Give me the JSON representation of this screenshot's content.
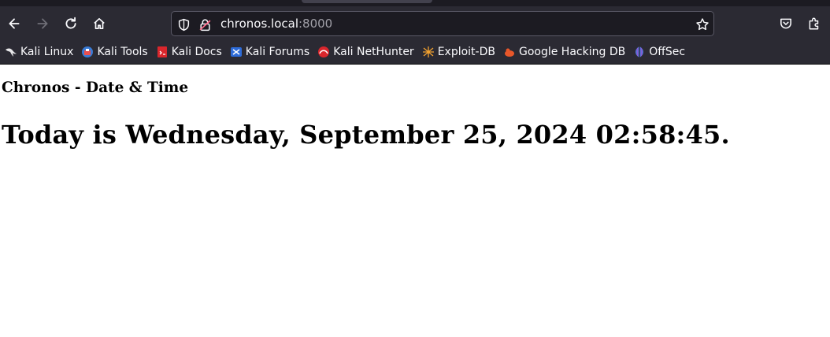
{
  "browser": {
    "url_host": "chronos.local",
    "url_port": ":8000",
    "bookmarks": [
      {
        "label": "Kali Linux",
        "icon": "kali-dragon-icon"
      },
      {
        "label": "Kali Tools",
        "icon": "kali-tools-icon"
      },
      {
        "label": "Kali Docs",
        "icon": "kali-docs-icon"
      },
      {
        "label": "Kali Forums",
        "icon": "kali-forums-icon"
      },
      {
        "label": "Kali NetHunter",
        "icon": "kali-nethunter-icon"
      },
      {
        "label": "Exploit-DB",
        "icon": "exploit-db-icon"
      },
      {
        "label": "Google Hacking DB",
        "icon": "google-hacking-db-icon"
      },
      {
        "label": "OffSec",
        "icon": "offsec-icon"
      }
    ]
  },
  "page": {
    "site_title": "Chronos - Date & Time",
    "headline": "Today is Wednesday, September 25, 2024 02:58:45."
  }
}
